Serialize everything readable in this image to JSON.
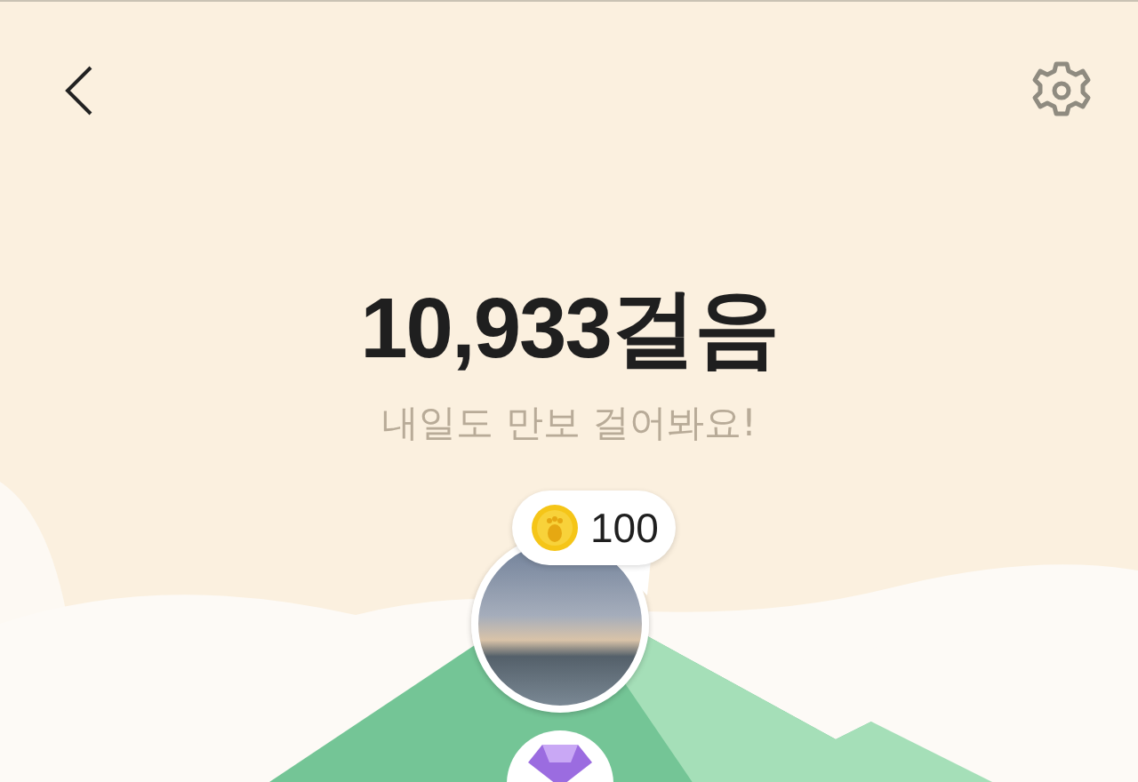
{
  "steps": "10,933걸음",
  "message": "내일도 만보 걸어봐요!",
  "reward": {
    "amount": "100"
  }
}
